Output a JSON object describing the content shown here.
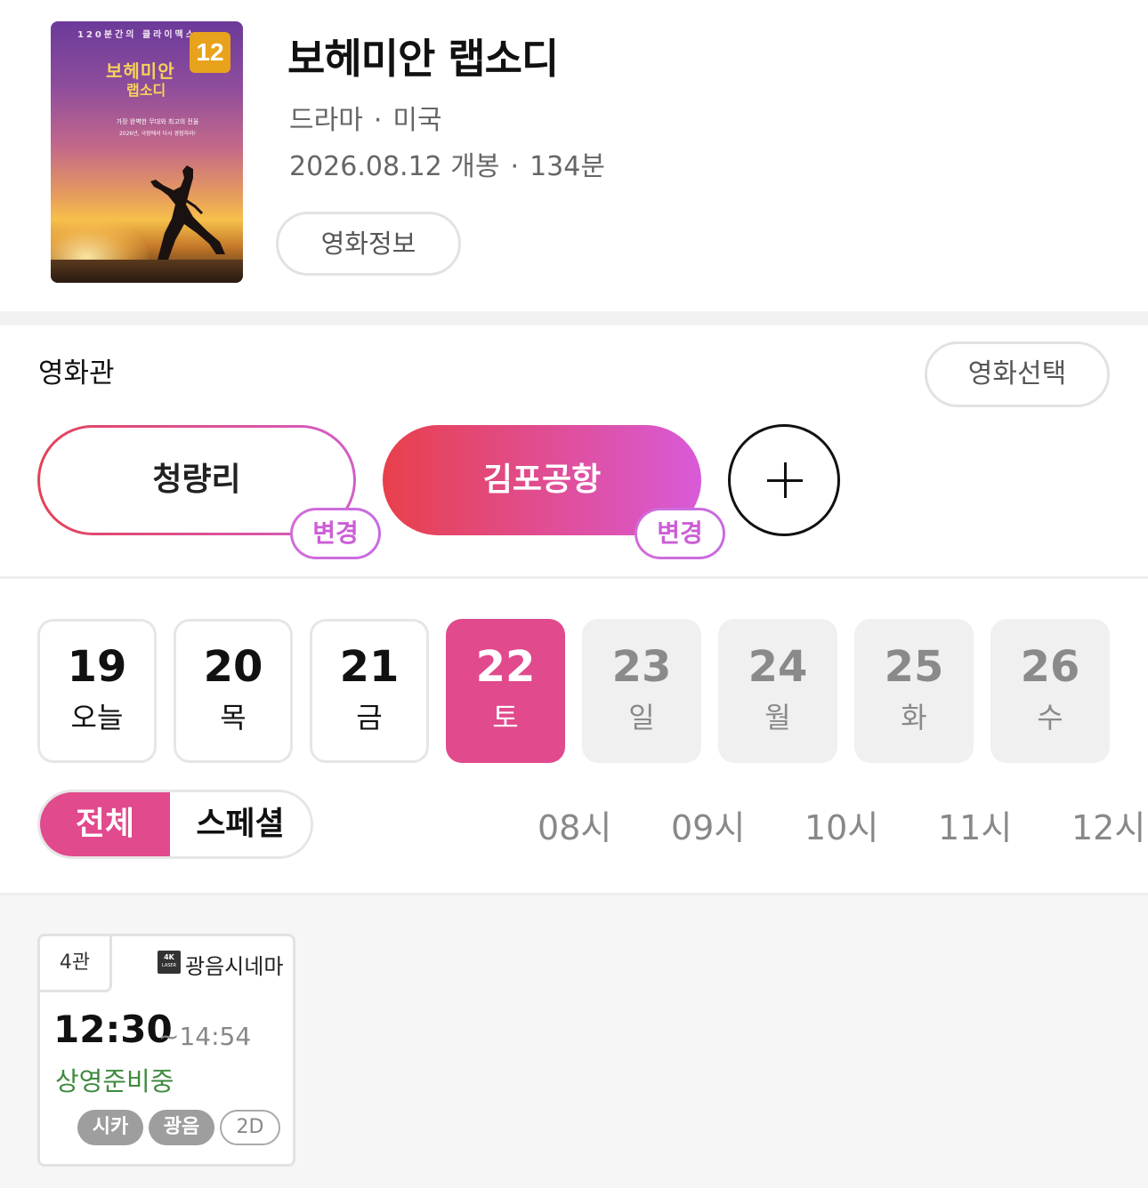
{
  "movie": {
    "title": "보헤미안 랩소디",
    "genre": "드라마",
    "country": "미국",
    "separator": "·",
    "release": "2026.08.12 개봉",
    "runtime": "134분",
    "info_button": "영화정보",
    "poster": {
      "top_text": "120분간의 클라이맥스",
      "title_line1": "보헤미안",
      "title_line2": "랩소디",
      "tagline1": "가장 완벽한 무대와 최고의 전율",
      "tagline2": "2026년, 극장에서 다시 경험하라!",
      "age_rating": "12"
    }
  },
  "theater": {
    "label": "영화관",
    "select_movie_button": "영화선택",
    "cinemas": [
      {
        "name": "청량리",
        "change_label": "변경",
        "selected": false
      },
      {
        "name": "김포공항",
        "change_label": "변경",
        "selected": true
      }
    ],
    "add_icon": "plus-icon"
  },
  "dates": [
    {
      "day": "19",
      "weekday": "오늘",
      "state": "available"
    },
    {
      "day": "20",
      "weekday": "목",
      "state": "available"
    },
    {
      "day": "21",
      "weekday": "금",
      "state": "available"
    },
    {
      "day": "22",
      "weekday": "토",
      "state": "selected"
    },
    {
      "day": "23",
      "weekday": "일",
      "state": "disabled"
    },
    {
      "day": "24",
      "weekday": "월",
      "state": "disabled"
    },
    {
      "day": "25",
      "weekday": "화",
      "state": "disabled"
    },
    {
      "day": "26",
      "weekday": "수",
      "state": "disabled"
    }
  ],
  "filter": {
    "all": "전체",
    "special": "스페셜",
    "active": "all"
  },
  "hours": [
    "08시",
    "09시",
    "10시",
    "11시",
    "12시"
  ],
  "showtimes": [
    {
      "hall": "4관",
      "projector_badge": "4K",
      "projector_badge_sub": "LASER",
      "brand": "광음시네마",
      "start": "12:30",
      "end": "~14:54",
      "status": "상영준비중",
      "tags": [
        "시카",
        "광음",
        "2D"
      ]
    }
  ],
  "colors": {
    "accent": "#e14a8c",
    "gradient_start": "#e8404b",
    "gradient_end": "#d85ad8",
    "status_green": "#3f8a3f"
  }
}
